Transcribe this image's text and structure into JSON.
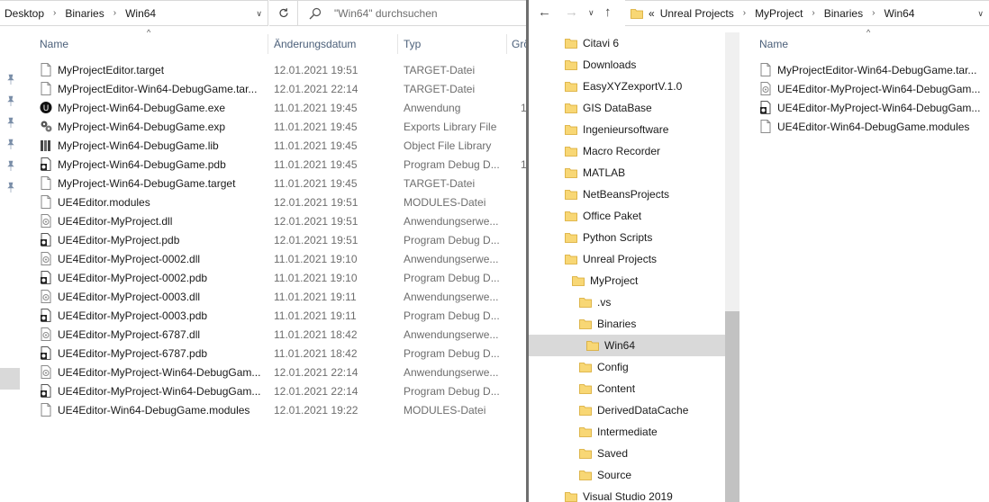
{
  "left": {
    "breadcrumb": [
      "Desktop",
      "Binaries",
      "Win64"
    ],
    "search_placeholder": "\"Win64\" durchsuchen",
    "columns": {
      "name": "Name",
      "date": "Änderungsdatum",
      "type": "Typ",
      "size": "Grö"
    },
    "files": [
      {
        "name": "MyProjectEditor.target",
        "date": "12.01.2021 19:51",
        "type": "TARGET-Datei",
        "size": "",
        "icon": "generic-file-icon"
      },
      {
        "name": "MyProjectEditor-Win64-DebugGame.tar...",
        "date": "12.01.2021 22:14",
        "type": "TARGET-Datei",
        "size": "",
        "icon": "generic-file-icon"
      },
      {
        "name": "MyProject-Win64-DebugGame.exe",
        "date": "11.01.2021 19:45",
        "type": "Anwendung",
        "size": "1",
        "icon": "unreal-exe-icon"
      },
      {
        "name": "MyProject-Win64-DebugGame.exp",
        "date": "11.01.2021 19:45",
        "type": "Exports Library File",
        "size": "",
        "icon": "gears-file-icon"
      },
      {
        "name": "MyProject-Win64-DebugGame.lib",
        "date": "11.01.2021 19:45",
        "type": "Object File Library",
        "size": "",
        "icon": "library-file-icon"
      },
      {
        "name": "MyProject-Win64-DebugGame.pdb",
        "date": "11.01.2021 19:45",
        "type": "Program Debug D...",
        "size": "1",
        "icon": "pdb-file-icon"
      },
      {
        "name": "MyProject-Win64-DebugGame.target",
        "date": "11.01.2021 19:45",
        "type": "TARGET-Datei",
        "size": "",
        "icon": "generic-file-icon"
      },
      {
        "name": "UE4Editor.modules",
        "date": "12.01.2021 19:51",
        "type": "MODULES-Datei",
        "size": "",
        "icon": "generic-file-icon"
      },
      {
        "name": "UE4Editor-MyProject.dll",
        "date": "12.01.2021 19:51",
        "type": "Anwendungserwe...",
        "size": "",
        "icon": "dll-file-icon"
      },
      {
        "name": "UE4Editor-MyProject.pdb",
        "date": "12.01.2021 19:51",
        "type": "Program Debug D...",
        "size": "",
        "icon": "pdb-file-icon"
      },
      {
        "name": "UE4Editor-MyProject-0002.dll",
        "date": "11.01.2021 19:10",
        "type": "Anwendungserwe...",
        "size": "",
        "icon": "dll-file-icon"
      },
      {
        "name": "UE4Editor-MyProject-0002.pdb",
        "date": "11.01.2021 19:10",
        "type": "Program Debug D...",
        "size": "",
        "icon": "pdb-file-icon"
      },
      {
        "name": "UE4Editor-MyProject-0003.dll",
        "date": "11.01.2021 19:11",
        "type": "Anwendungserwe...",
        "size": "",
        "icon": "dll-file-icon"
      },
      {
        "name": "UE4Editor-MyProject-0003.pdb",
        "date": "11.01.2021 19:11",
        "type": "Program Debug D...",
        "size": "",
        "icon": "pdb-file-icon"
      },
      {
        "name": "UE4Editor-MyProject-6787.dll",
        "date": "11.01.2021 18:42",
        "type": "Anwendungserwe...",
        "size": "",
        "icon": "dll-file-icon"
      },
      {
        "name": "UE4Editor-MyProject-6787.pdb",
        "date": "11.01.2021 18:42",
        "type": "Program Debug D...",
        "size": "",
        "icon": "pdb-file-icon"
      },
      {
        "name": "UE4Editor-MyProject-Win64-DebugGam...",
        "date": "12.01.2021 22:14",
        "type": "Anwendungserwe...",
        "size": "",
        "icon": "dll-file-icon"
      },
      {
        "name": "UE4Editor-MyProject-Win64-DebugGam...",
        "date": "12.01.2021 22:14",
        "type": "Program Debug D...",
        "size": "",
        "icon": "pdb-file-icon"
      },
      {
        "name": "UE4Editor-Win64-DebugGame.modules",
        "date": "12.01.2021 19:22",
        "type": "MODULES-Datei",
        "size": "",
        "icon": "generic-file-icon"
      }
    ]
  },
  "right": {
    "breadcrumb_prefix": "«",
    "breadcrumb": [
      "Unreal Projects",
      "MyProject",
      "Binaries",
      "Win64"
    ],
    "tree": [
      {
        "label": "Citavi 6",
        "level": 0,
        "selected": false
      },
      {
        "label": "Downloads",
        "level": 0,
        "selected": false
      },
      {
        "label": "EasyXYZexportV.1.0",
        "level": 0,
        "selected": false
      },
      {
        "label": "GIS DataBase",
        "level": 0,
        "selected": false
      },
      {
        "label": "Ingenieursoftware",
        "level": 0,
        "selected": false
      },
      {
        "label": "Macro Recorder",
        "level": 0,
        "selected": false
      },
      {
        "label": "MATLAB",
        "level": 0,
        "selected": false
      },
      {
        "label": "NetBeansProjects",
        "level": 0,
        "selected": false
      },
      {
        "label": "Office Paket",
        "level": 0,
        "selected": false
      },
      {
        "label": "Python Scripts",
        "level": 0,
        "selected": false
      },
      {
        "label": "Unreal Projects",
        "level": 0,
        "selected": false
      },
      {
        "label": "MyProject",
        "level": 1,
        "selected": false
      },
      {
        "label": ".vs",
        "level": 2,
        "selected": false
      },
      {
        "label": "Binaries",
        "level": 2,
        "selected": false
      },
      {
        "label": "Win64",
        "level": 3,
        "selected": true
      },
      {
        "label": "Config",
        "level": 2,
        "selected": false
      },
      {
        "label": "Content",
        "level": 2,
        "selected": false
      },
      {
        "label": "DerivedDataCache",
        "level": 2,
        "selected": false
      },
      {
        "label": "Intermediate",
        "level": 2,
        "selected": false
      },
      {
        "label": "Saved",
        "level": 2,
        "selected": false
      },
      {
        "label": "Source",
        "level": 2,
        "selected": false
      },
      {
        "label": "Visual Studio 2019",
        "level": 0,
        "selected": false
      }
    ],
    "columns": {
      "name": "Name"
    },
    "files": [
      {
        "name": "MyProjectEditor-Win64-DebugGame.tar...",
        "icon": "generic-file-icon"
      },
      {
        "name": "UE4Editor-MyProject-Win64-DebugGam...",
        "icon": "dll-file-icon"
      },
      {
        "name": "UE4Editor-MyProject-Win64-DebugGam...",
        "icon": "pdb-file-icon"
      },
      {
        "name": "UE4Editor-Win64-DebugGame.modules",
        "icon": "generic-file-icon"
      }
    ]
  },
  "colors": {
    "header_text": "#4c607a",
    "secondary_text": "#6d6d6d",
    "folder_yellow": "#f8d775",
    "selection": "#d9d9d9"
  }
}
